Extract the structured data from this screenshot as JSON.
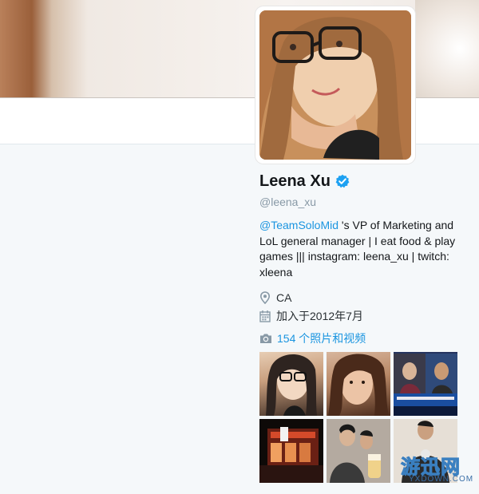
{
  "profile": {
    "name": "Leena Xu",
    "handle": "@leena_xu",
    "bio_mention": "@TeamSoloMid",
    "bio_text": " 's VP of Marketing and LoL general manager | I eat food & play games ||| instagram: leena_xu | twitch: xleena",
    "location": "CA",
    "joined": "加入于2012年7月"
  },
  "media": {
    "label": "154 个照片和视频",
    "thumbnails": [
      "photo-1",
      "photo-2",
      "photo-3",
      "photo-4",
      "photo-5",
      "photo-6"
    ]
  },
  "icons": {
    "verified": "verified-badge-icon",
    "location": "map-pin-icon",
    "joined": "calendar-icon",
    "media": "camera-icon"
  },
  "colors": {
    "link": "#1b95e0",
    "verified": "#1da1f2",
    "muted": "#8899a6"
  },
  "watermark": {
    "chinese": "游迅网",
    "latin": "YXDOWN.COM"
  }
}
